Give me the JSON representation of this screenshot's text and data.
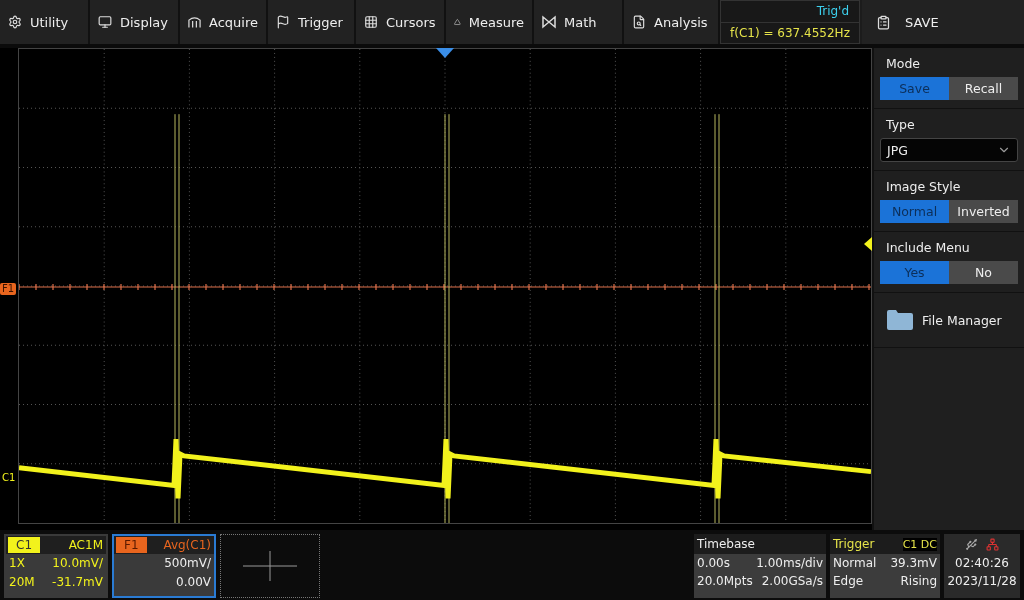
{
  "menu": [
    {
      "label": "Utility"
    },
    {
      "label": "Display"
    },
    {
      "label": "Acquire"
    },
    {
      "label": "Trigger"
    },
    {
      "label": "Cursors"
    },
    {
      "label": "Measure"
    },
    {
      "label": "Math"
    },
    {
      "label": "Analysis"
    }
  ],
  "status": {
    "state": "Trig'd",
    "frequency": "f(C1) = 637.4552Hz"
  },
  "panel": {
    "title": "SAVE",
    "sections": [
      {
        "kind": "toggle",
        "label": "Mode",
        "options": [
          {
            "label": "Save",
            "selected": true
          },
          {
            "label": "Recall",
            "selected": false
          }
        ]
      },
      {
        "kind": "dropdown",
        "label": "Type",
        "value": "JPG"
      },
      {
        "kind": "toggle",
        "label": "Image Style",
        "options": [
          {
            "label": "Normal",
            "selected": true
          },
          {
            "label": "Inverted",
            "selected": false
          }
        ]
      },
      {
        "kind": "toggle",
        "label": "Include Menu",
        "options": [
          {
            "label": "Yes",
            "selected": true
          },
          {
            "label": "No",
            "selected": false
          }
        ]
      },
      {
        "kind": "link",
        "label": "File Manager"
      }
    ]
  },
  "markers": {
    "math": "F1",
    "channel": "C1"
  },
  "channels": [
    {
      "kind": "channel",
      "name": "C1",
      "coupling": "AC1M",
      "rows": [
        [
          "1X",
          "10.0mV/"
        ],
        [
          "20M",
          "-31.7mV"
        ]
      ],
      "selected": false
    },
    {
      "kind": "math",
      "name": "F1",
      "coupling": "Avg(C1)",
      "rows": [
        [
          "",
          "500mV/"
        ],
        [
          "",
          "0.00V"
        ]
      ],
      "selected": true
    }
  ],
  "timebase": {
    "title": "Timebase",
    "rows": [
      [
        "0.00s",
        "1.00ms/div"
      ],
      [
        "20.0Mpts",
        "2.00GSa/s"
      ]
    ]
  },
  "trigger": {
    "title": "Trigger",
    "source": "C1 DC",
    "rows": [
      [
        "Normal",
        "39.3mV"
      ],
      [
        "Edge",
        "Rising"
      ]
    ]
  },
  "clock": {
    "time": "02:40:26",
    "date": "2023/11/28"
  }
}
